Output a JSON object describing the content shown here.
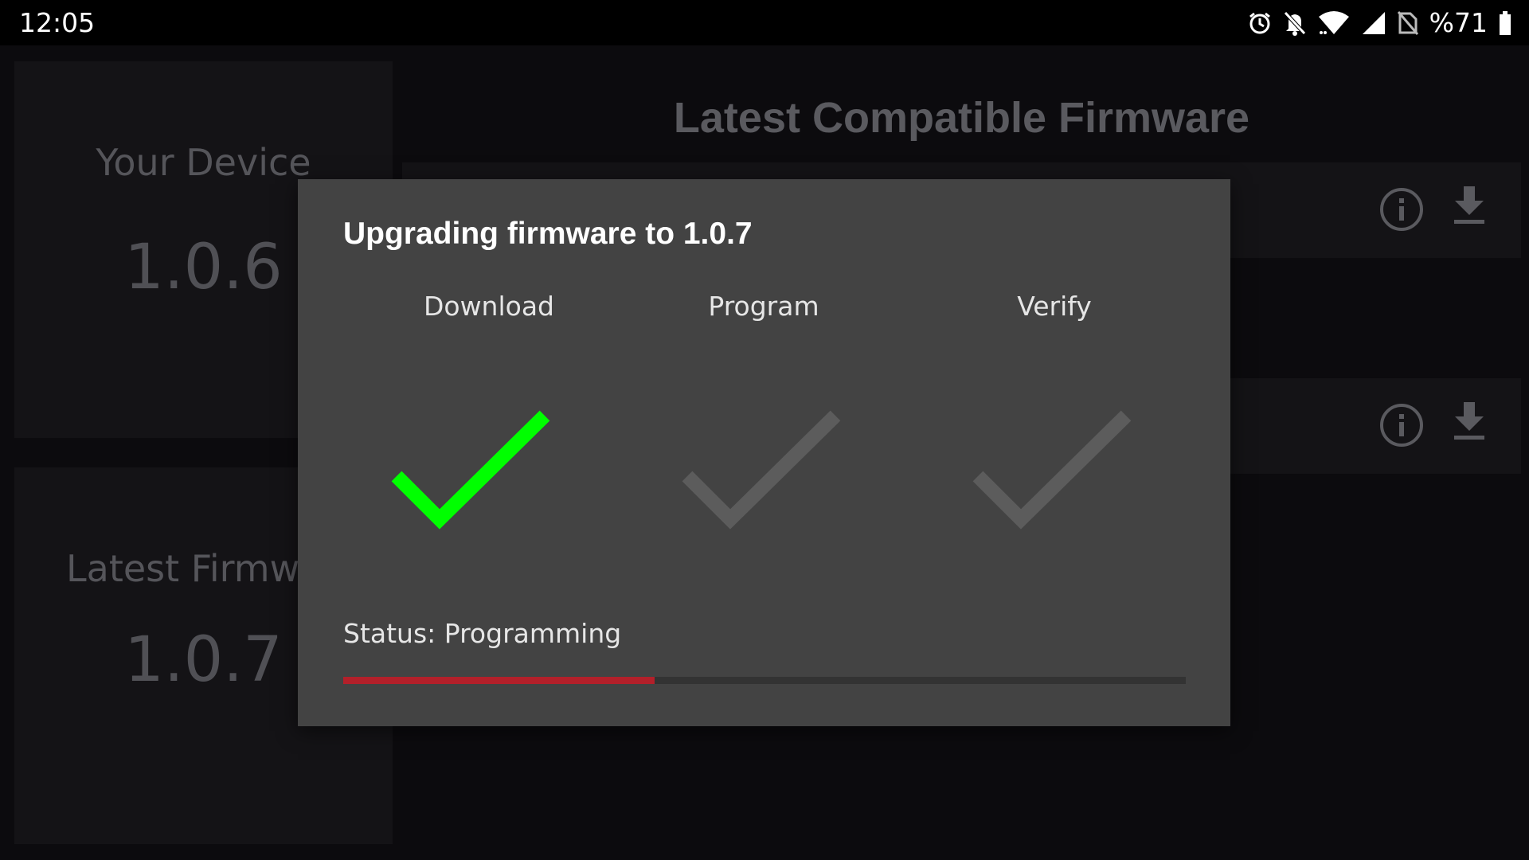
{
  "status_bar": {
    "time": "12:05",
    "battery_percent": "%71",
    "icons": [
      "alarm-icon",
      "notifications-off-icon",
      "wifi-icon",
      "signal-icon",
      "no-sim-icon",
      "battery-icon"
    ]
  },
  "app": {
    "your_device": {
      "title": "Your Device",
      "version": "1.0.6"
    },
    "latest_firmware": {
      "title": "Latest Firmware",
      "version": "1.0.7"
    },
    "compatible_section": {
      "title": "Latest Compatible Firmware",
      "rows": [
        {
          "icons": [
            "info-icon",
            "download-icon"
          ]
        },
        {
          "icons": [
            "info-icon",
            "download-icon"
          ]
        }
      ]
    }
  },
  "dialog": {
    "title": "Upgrading firmware to 1.0.7",
    "steps": [
      {
        "label": "Download",
        "state": "complete"
      },
      {
        "label": "Program",
        "state": "pending"
      },
      {
        "label": "Verify",
        "state": "pending"
      }
    ],
    "status": "Status: Programming",
    "progress_fraction": 0.37
  },
  "colors": {
    "step_complete": "#00ff00",
    "step_pending": "#5c5c5c",
    "progress_fill": "#b3202a",
    "dialog_bg": "#434343"
  }
}
